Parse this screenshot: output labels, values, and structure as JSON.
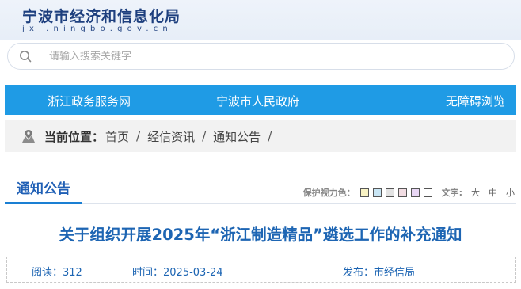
{
  "header": {
    "site_title": "宁波市经济和信息化局",
    "site_domain": "jxj.ningbo.gov.cn"
  },
  "search": {
    "placeholder": "请输入搜索关键字"
  },
  "nav": {
    "items": [
      {
        "label": "浙江政务服务网"
      },
      {
        "label": "宁波市人民政府"
      },
      {
        "label": "无障碍浏览"
      }
    ]
  },
  "breadcrumb": {
    "label": "当前位置：",
    "items": [
      "首页",
      "经信资讯",
      "通知公告"
    ],
    "separator": "/"
  },
  "tabs": {
    "active_label": "通知公告"
  },
  "tools": {
    "eye_label": "保护视力色：",
    "swatches": [
      "#f9f3c4",
      "#c9e6f5",
      "#e3e3e3",
      "#f2dde3",
      "#e9d7f5",
      "#ffffff"
    ],
    "font_label": "文字:",
    "sizes": [
      "大",
      "中",
      "小"
    ]
  },
  "article": {
    "title": "关于组织开展2025年“浙江制造精品”遴选工作的补充通知",
    "reads": "阅读：312",
    "time": "时间：2025-03-24",
    "source": "发布：市经信局"
  },
  "colors": {
    "nav_bg": "#1f9be5",
    "title_blue": "#1d65b3",
    "tab_underline": "#1a7fd3"
  }
}
